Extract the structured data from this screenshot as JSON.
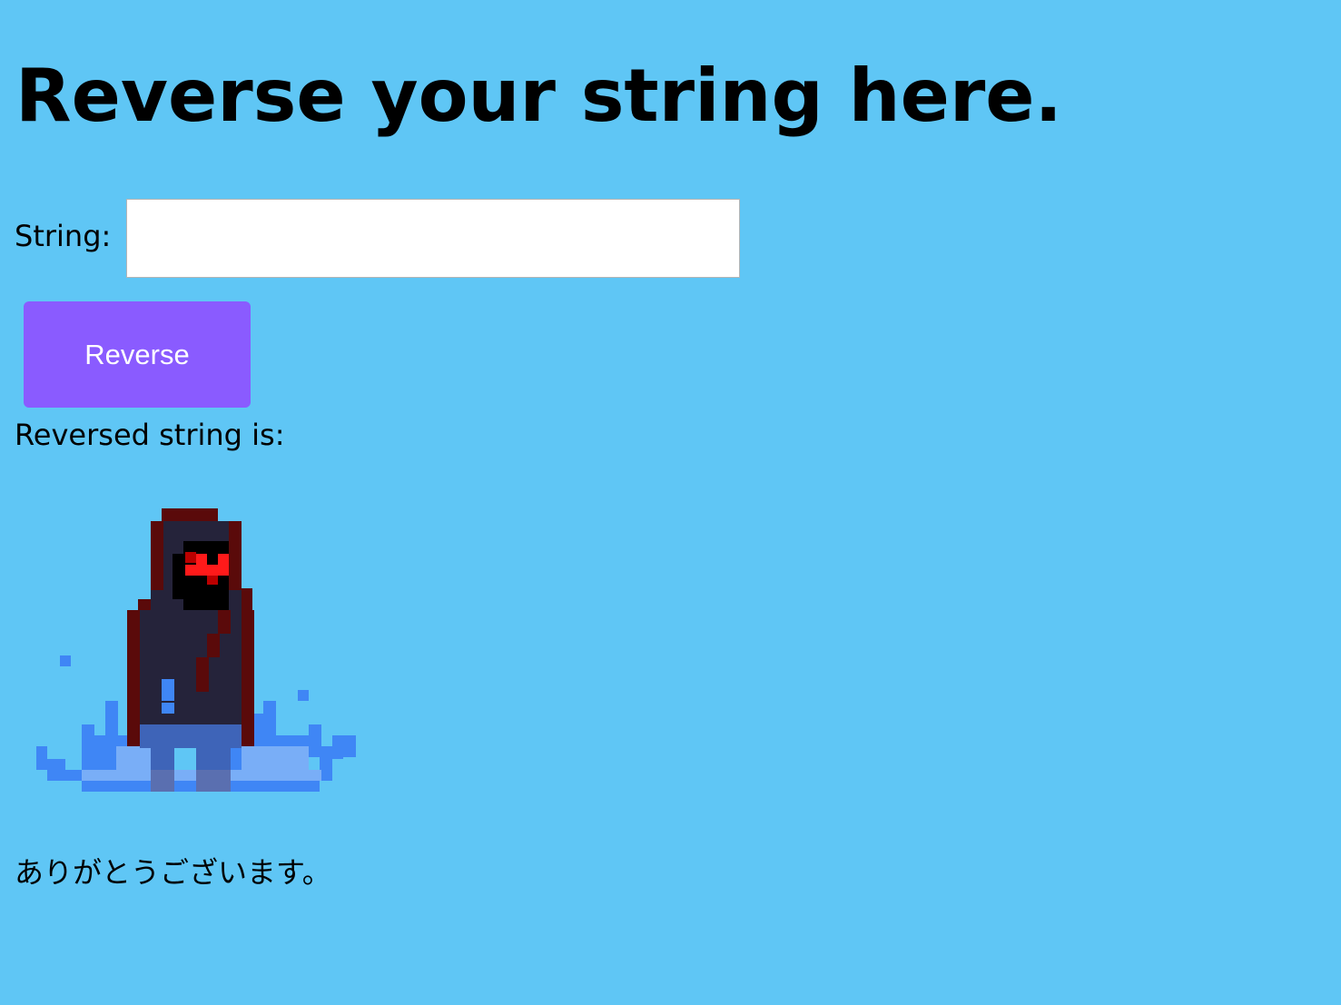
{
  "header": {
    "title": "Reverse your string here."
  },
  "form": {
    "string_label": "String:",
    "string_value": "",
    "reverse_button_label": "Reverse"
  },
  "result": {
    "label": "Reversed string is:",
    "value": "ありがとうございます。"
  },
  "colors": {
    "background": "#5fc6f5",
    "button": "#8a5bff",
    "button_text": "#ffffff"
  },
  "image": {
    "icon": "hooded-reaper-splash-sprite-icon"
  }
}
